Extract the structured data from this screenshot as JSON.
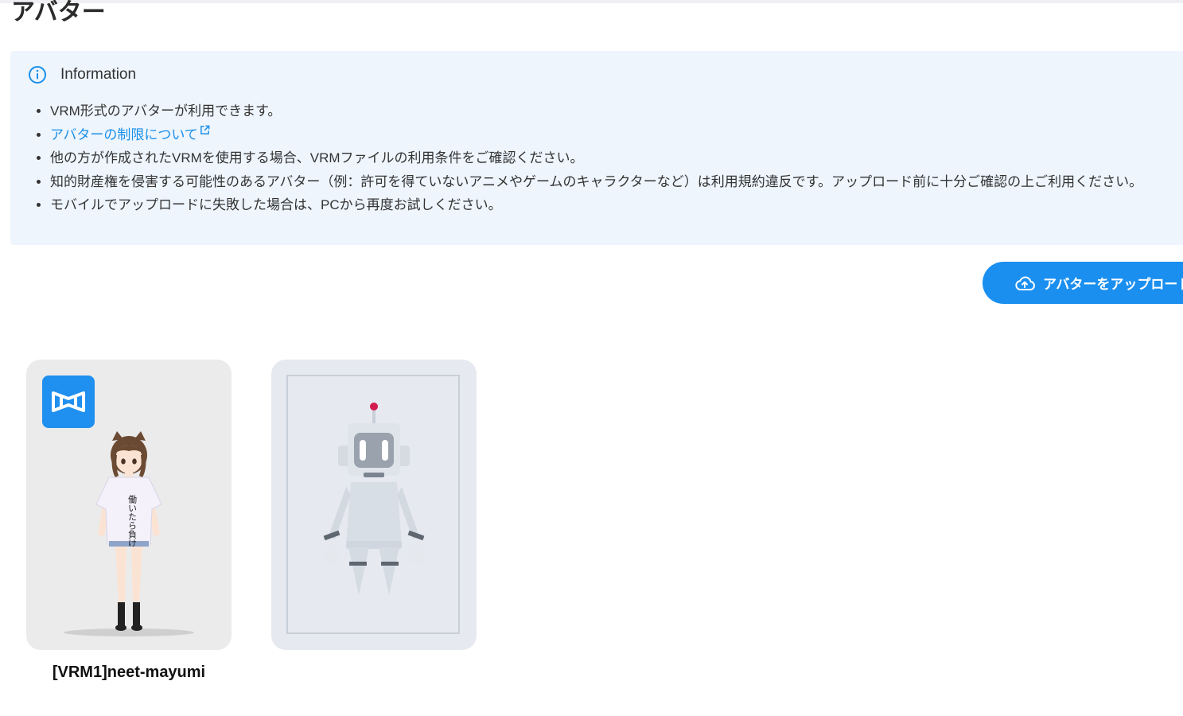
{
  "page": {
    "title": "アバター"
  },
  "info": {
    "title": "Information",
    "icon": "info-icon",
    "items": [
      "VRM形式のアバターが利用できます。",
      "アバターの制限について",
      "他の方が作成されたVRMを使用する場合、VRMファイルの利用条件をご確認ください。",
      "知的財産権を侵害する可能性のあるアバター（例：許可を得ていないアニメやゲームのキャラクターなど）は利用規約違反です。アップロード前に十分ご確認の上ご利用ください。",
      "モバイルでアップロードに失敗した場合は、PCから再度お試しください。"
    ]
  },
  "upload": {
    "label": "アバターをアップロード",
    "icon": "cloud-upload-icon",
    "color": "#1a8ff0"
  },
  "avatars": [
    {
      "name": "[VRM1]neet-mayumi",
      "badge_icon": "vrm-logo-icon",
      "shirt_text": "働いたら負け"
    },
    {
      "name": ""
    }
  ],
  "colors": {
    "accent": "#1a8ff0",
    "info_bg": "#eef5fd",
    "link": "#1a8fe8"
  }
}
